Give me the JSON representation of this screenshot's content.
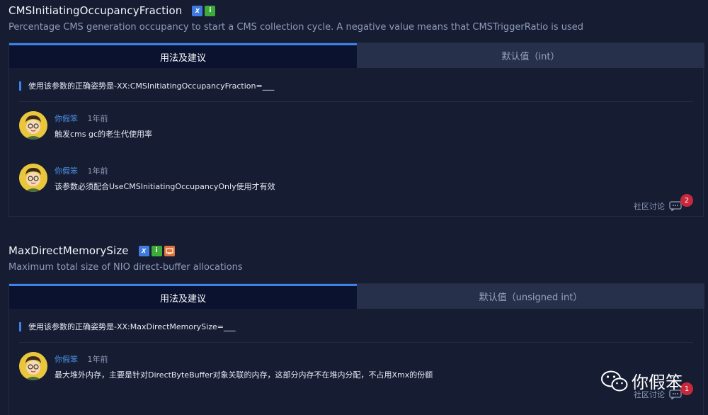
{
  "params": [
    {
      "name": "CMSInitiatingOccupancyFraction",
      "badges": [
        "x-icon",
        "info-icon"
      ],
      "description": "Percentage CMS generation occupancy to start a CMS collection cycle. A negative value means that CMSTriggerRatio is used",
      "tab_active": "用法及建议",
      "tab_inactive": "默认值（int）",
      "usage": "使用该参数的正确姿势是-XX:CMSInitiatingOccupancyFraction=___",
      "comments": [
        {
          "author": "你假笨",
          "time": "1年前",
          "text": "触发cms gc的老生代使用率"
        },
        {
          "author": "你假笨",
          "time": "1年前",
          "text": "该参数必须配合UseCMSInitiatingOccupancyOnly使用才有效"
        }
      ],
      "discuss_label": "社区讨论",
      "discuss_count": "2"
    },
    {
      "name": "MaxDirectMemorySize",
      "badges": [
        "x-icon",
        "info-icon",
        "computer-icon"
      ],
      "description": "Maximum total size of NIO direct-buffer allocations",
      "tab_active": "用法及建议",
      "tab_inactive": "默认值（unsigned int）",
      "usage": "使用该参数的正确姿势是-XX:MaxDirectMemorySize=___",
      "comments": [
        {
          "author": "你假笨",
          "time": "1年前",
          "text": "最大堆外内存，主要是针对DirectByteBuffer对象关联的内存，这部分内存不在堆内分配，不占用Xmx的份额"
        }
      ],
      "discuss_label": "社区讨论",
      "discuss_count": "1"
    }
  ],
  "watermark": {
    "text": "你假笨",
    "icon": "wechat-icon"
  },
  "colors": {
    "accent": "#3d82e8",
    "badge_red": "#c9283a",
    "author": "#4d8fe6"
  }
}
